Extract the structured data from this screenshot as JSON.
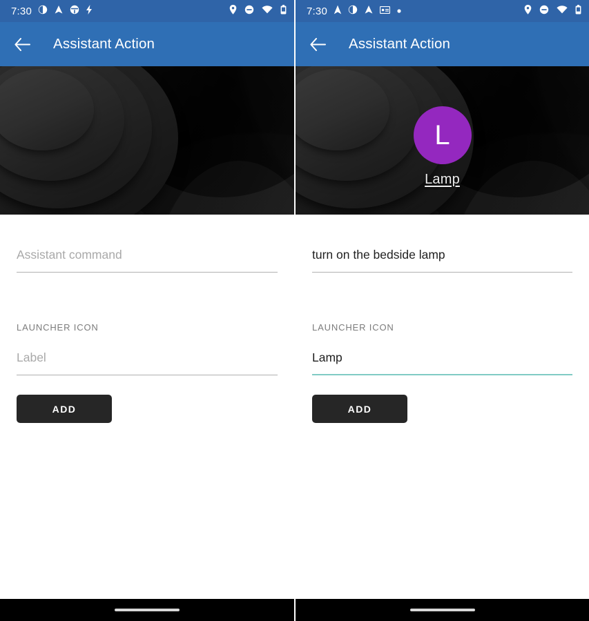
{
  "screens": [
    {
      "id": "left",
      "status_bar": {
        "time": "7:30",
        "left_icons": [
          "half-circle-icon",
          "triangle-a-icon",
          "steering-wheel-icon",
          "bolt-icon"
        ],
        "right_icons": [
          "location-pin-icon",
          "do-not-disturb-icon",
          "wifi-icon",
          "battery-icon"
        ]
      },
      "app_bar": {
        "back_icon": "back-arrow-icon",
        "title": "Assistant Action"
      },
      "hero": {
        "wallpaper": "dark-abstract-rings-wallpaper",
        "launcher_preview_visible": false,
        "launcher_letter": "",
        "launcher_label": ""
      },
      "command_field": {
        "value": "",
        "placeholder": "Assistant command",
        "focused": false
      },
      "section_label": "LAUNCHER ICON",
      "label_field": {
        "value": "",
        "placeholder": "Label",
        "focused": false
      },
      "add_button": "ADD"
    },
    {
      "id": "right",
      "status_bar": {
        "time": "7:30",
        "left_icons": [
          "navigation-arrow-icon",
          "half-circle-icon",
          "triangle-a-icon",
          "id-card-icon",
          "dot-icon"
        ],
        "right_icons": [
          "location-pin-icon",
          "do-not-disturb-icon",
          "wifi-icon",
          "battery-icon"
        ]
      },
      "app_bar": {
        "back_icon": "back-arrow-icon",
        "title": "Assistant Action"
      },
      "hero": {
        "wallpaper": "dark-abstract-rings-wallpaper",
        "launcher_preview_visible": true,
        "launcher_letter": "L",
        "launcher_label": "Lamp"
      },
      "command_field": {
        "value": "turn on the bedside lamp",
        "placeholder": "Assistant command",
        "focused": false
      },
      "section_label": "LAUNCHER ICON",
      "label_field": {
        "value": "Lamp",
        "placeholder": "Label",
        "focused": true
      },
      "add_button": "ADD"
    }
  ],
  "colors": {
    "status_bar": "#2f64a8",
    "app_bar": "#2f6fb5",
    "launcher_circle": "#9428bf",
    "focused_underline": "#80cbc4",
    "button": "#262626",
    "nav_bar": "#000000"
  }
}
